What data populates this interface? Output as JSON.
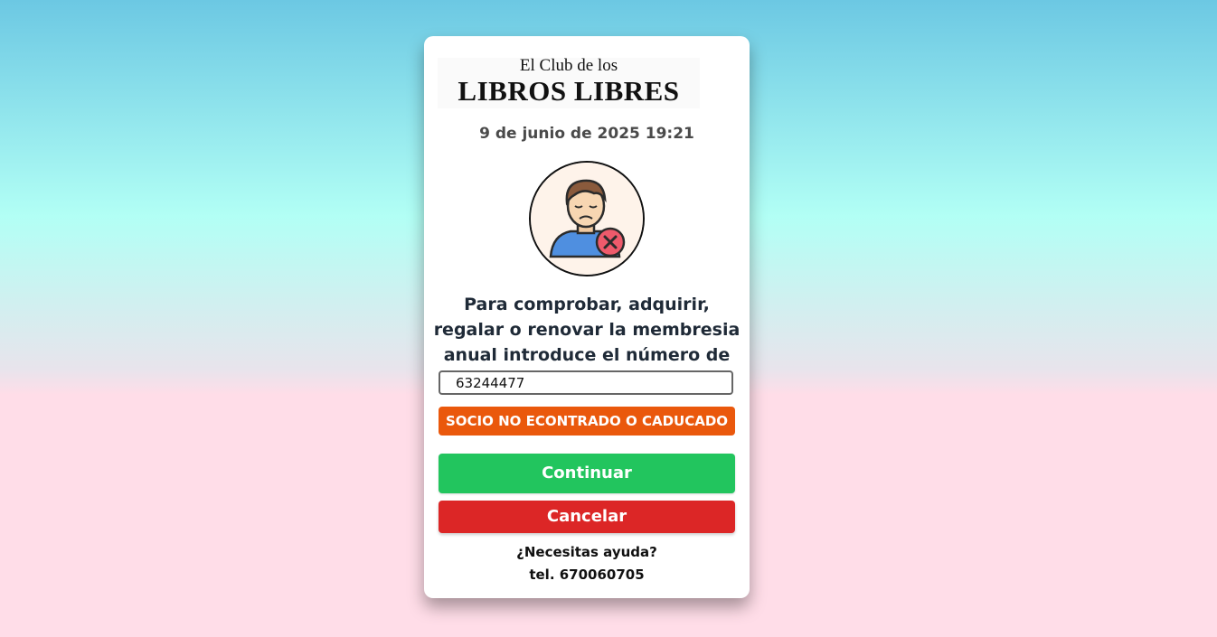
{
  "logo": {
    "line1": "El Club de los",
    "line2": "LIBROS LIBRES"
  },
  "datetime": "9 de junio de 2025 19:21",
  "avatar": {
    "icon": "user-not-found-icon"
  },
  "instructions": "Para comprobar, adquirir, regalar o renovar la membresia anual introduce el número de télefono.",
  "phone_input": {
    "value": "63244477"
  },
  "status_message": "SOCIO NO ECONTRADO O CADUCADO",
  "buttons": {
    "continue": "Continuar",
    "cancel": "Cancelar"
  },
  "help": {
    "question": "¿Necesitas ayuda?",
    "phone": "tel. 670060705"
  },
  "colors": {
    "status": "#ea580c",
    "continue": "#22c55e",
    "cancel": "#dc2626"
  }
}
